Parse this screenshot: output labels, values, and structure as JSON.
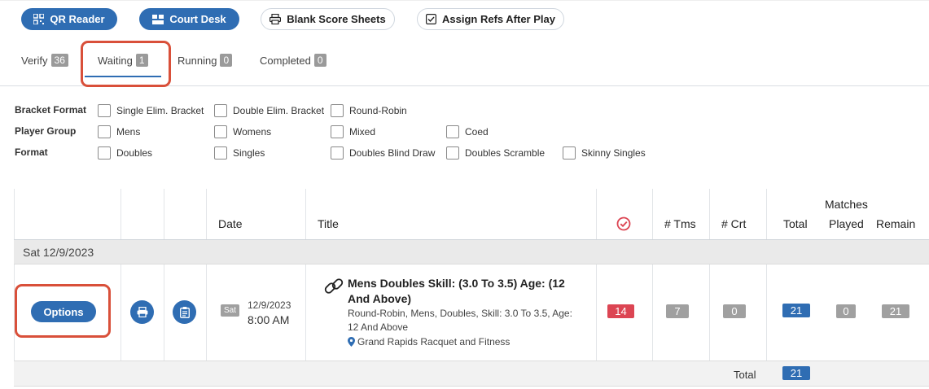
{
  "toolbar": {
    "qr_reader": "QR Reader",
    "court_desk": "Court Desk",
    "blank_score_sheets": "Blank Score Sheets",
    "assign_refs": "Assign Refs After Play"
  },
  "tabs": [
    {
      "label": "Verify",
      "count": "36"
    },
    {
      "label": "Waiting",
      "count": "1",
      "active": true
    },
    {
      "label": "Running",
      "count": "0"
    },
    {
      "label": "Completed",
      "count": "0"
    }
  ],
  "filters": {
    "bracket_format": {
      "label": "Bracket Format",
      "options": [
        "Single Elim. Bracket",
        "Double Elim. Bracket",
        "Round-Robin"
      ]
    },
    "player_group": {
      "label": "Player Group",
      "options": [
        "Mens",
        "Womens",
        "Mixed",
        "Coed"
      ]
    },
    "format": {
      "label": "Format",
      "options": [
        "Doubles",
        "Singles",
        "Doubles Blind Draw",
        "Doubles Scramble",
        "Skinny Singles"
      ]
    }
  },
  "table": {
    "headers": {
      "date": "Date",
      "title": "Title",
      "teams": "# Tms",
      "courts": "# Crt",
      "matches": "Matches",
      "total": "Total",
      "played": "Played",
      "remain": "Remain"
    },
    "group_label": "Sat 12/9/2023",
    "row": {
      "options_label": "Options",
      "day": "Sat",
      "date": "12/9/2023",
      "time": "8:00 AM",
      "title": "Mens Doubles Skill: (3.0 To 3.5) Age: (12 And Above)",
      "subtitle": "Round-Robin, Mens, Doubles, Skill: 3.0 To 3.5, Age: 12 And Above",
      "location": "Grand Rapids Racquet and Fitness",
      "checked": "14",
      "teams": "7",
      "courts": "0",
      "matches_total": "21",
      "matches_played": "0",
      "matches_remain": "21"
    },
    "footer": {
      "label": "Total",
      "value": "21"
    }
  },
  "colors": {
    "primary": "#2f6db3",
    "danger": "#dc4553",
    "highlight": "#d9503a",
    "badge_grey": "#a0a0a0"
  }
}
